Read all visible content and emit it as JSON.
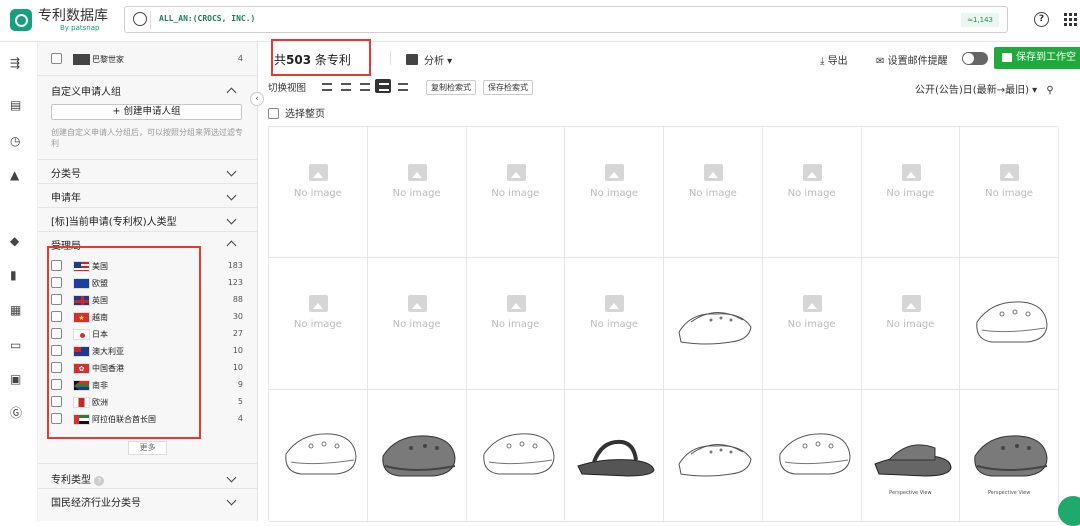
{
  "header": {
    "app_title": "专利数据库",
    "app_subtitle": "By patsnap",
    "search_query": "ALL_AN:(CROCS, INC.)",
    "search_count": "≈1,143"
  },
  "sidebar": {
    "top_item": {
      "label": "巴黎世家",
      "count": "4"
    },
    "custom_group": {
      "title": "自定义申请人组",
      "create_label": "+ 创建申请人组",
      "description": "创建自定义申请人分组后，可以按照分组来筛选过滤专利"
    },
    "sections": [
      "分类号",
      "申请年",
      "[标]当前申请(专利权)人类型"
    ],
    "authority": {
      "title": "受理局",
      "items": [
        {
          "label": "美国",
          "count": "183"
        },
        {
          "label": "欧盟",
          "count": "123"
        },
        {
          "label": "英国",
          "count": "88"
        },
        {
          "label": "越南",
          "count": "30"
        },
        {
          "label": "日本",
          "count": "27"
        },
        {
          "label": "澳大利亚",
          "count": "10"
        },
        {
          "label": "中国香港",
          "count": "10"
        },
        {
          "label": "南非",
          "count": "9"
        },
        {
          "label": "欧洲",
          "count": "5"
        },
        {
          "label": "阿拉伯联合酋长国",
          "count": "4"
        }
      ],
      "more_label": "更多"
    },
    "bottom_sections": [
      "专利类型",
      "国民经济行业分类号"
    ]
  },
  "toolbar": {
    "total_prefix": "共",
    "total_count": "503",
    "total_suffix": "条专利",
    "analysis_label": "分析",
    "export_label": "导出",
    "email_alert_label": "设置邮件提醒",
    "save_workspace_label": "保存到工作空"
  },
  "view_bar": {
    "switch_label": "切换视图",
    "copy_query_label": "复制检索式",
    "save_query_label": "保存检索式",
    "sort_label": "公开(公告)日(最新→最旧)"
  },
  "select_page_label": "选择整页",
  "results": {
    "no_image_label": "No image",
    "cells": [
      "none",
      "none",
      "none",
      "none",
      "none",
      "none",
      "none",
      "none",
      "none",
      "none",
      "none",
      "none",
      "sandal-drawing",
      "none",
      "none",
      "clog-drawing",
      "clog-drawing",
      "clog-photo",
      "clog-drawing",
      "sandal-photo",
      "sandal-drawing",
      "clog-drawing",
      "slide-photo",
      "clog-photo"
    ],
    "captions": {
      "22": "Perspective View",
      "23": "Perspective View"
    }
  },
  "colors": {
    "accent": "#1faa3c",
    "highlight": "#e53935",
    "brand": "#16a07f"
  }
}
